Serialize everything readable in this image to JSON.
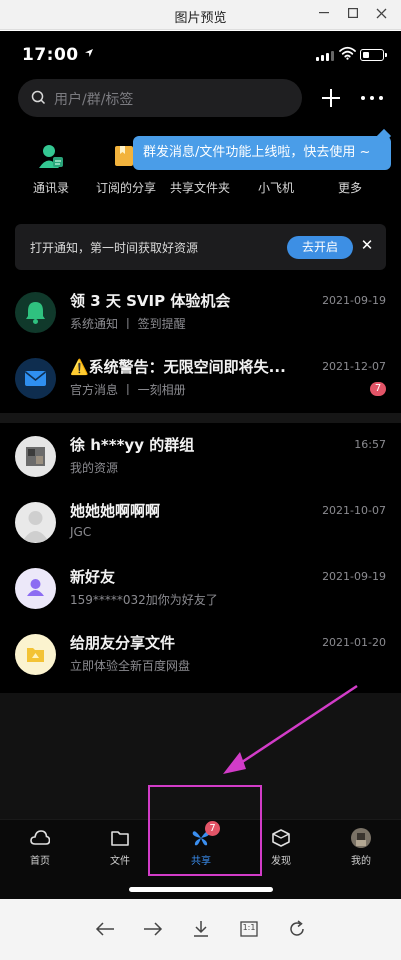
{
  "window": {
    "title": "图片预览",
    "minimize_icon": "minimize-icon",
    "maximize_icon": "maximize-icon",
    "close_icon": "close-icon"
  },
  "status_bar": {
    "time": "17:00",
    "location_icon": "location-arrow-icon",
    "signal_icon": "cellular-signal-icon",
    "wifi_icon": "wifi-icon",
    "battery_icon": "battery-icon"
  },
  "header": {
    "search_placeholder": "用户/群/标签",
    "add_icon": "plus-icon",
    "more_icon": "more-dots-icon"
  },
  "shortcuts": [
    {
      "label": "通讯录",
      "icon": "contacts-icon"
    },
    {
      "label": "订阅的分享",
      "icon": "subscription-icon"
    },
    {
      "label": "共享文件夹",
      "icon": "shared-folder-icon"
    },
    {
      "label": "小飞机",
      "icon": "paper-plane-icon"
    },
    {
      "label": "更多",
      "icon": "more-icon"
    }
  ],
  "tooltip": {
    "text": "群发消息/文件功能上线啦，快去使用 ~"
  },
  "notice": {
    "text": "打开通知，第一时间获取好资源",
    "button": "去开启",
    "close": "✕"
  },
  "system_messages": [
    {
      "title": "领 3 天 SVIP 体验机会",
      "subtitle": "系统通知  丨  签到提醒",
      "date": "2021-09-19",
      "icon": "bell-icon"
    },
    {
      "title": "⚠️系统警告：无限空间即将失...",
      "subtitle": "官方消息  丨  一刻相册",
      "date": "2021-12-07",
      "badge": "7",
      "icon": "mail-icon"
    }
  ],
  "conversations": [
    {
      "title": "徐 h***yy 的群组",
      "subtitle": "我的资源",
      "date": "16:57",
      "icon": "group-avatar"
    },
    {
      "title": "她她她啊啊啊",
      "subtitle": "JGC",
      "date": "2021-10-07",
      "icon": "default-avatar"
    },
    {
      "title": "新好友",
      "subtitle": "159*****032加你为好友了",
      "date": "2021-09-19",
      "icon": "new-friend-icon"
    },
    {
      "title": "给朋友分享文件",
      "subtitle": "立即体验全新百度网盘",
      "date": "2021-01-20",
      "icon": "share-file-icon"
    }
  ],
  "tabbar": [
    {
      "label": "首页",
      "icon": "cloud-home-icon"
    },
    {
      "label": "文件",
      "icon": "folder-icon"
    },
    {
      "label": "共享",
      "icon": "share-butterfly-icon",
      "badge": "7",
      "active": true
    },
    {
      "label": "发现",
      "icon": "discover-cube-icon"
    },
    {
      "label": "我的",
      "icon": "profile-avatar"
    }
  ],
  "viewer_toolbar": [
    {
      "icon": "back-arrow-icon"
    },
    {
      "icon": "forward-arrow-icon"
    },
    {
      "icon": "download-icon"
    },
    {
      "icon": "actual-size-icon",
      "label": "1:1"
    },
    {
      "icon": "rotate-icon"
    }
  ],
  "colors": {
    "accent": "#4a9de8",
    "badge": "#e25467",
    "annotation": "#d23cc8",
    "background": "#000000"
  }
}
